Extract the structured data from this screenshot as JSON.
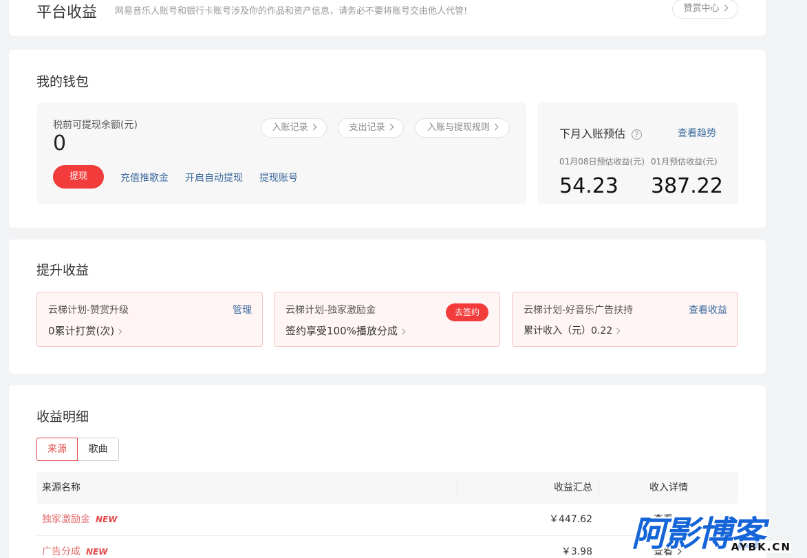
{
  "header": {
    "title": "平台收益",
    "notice": "网易音乐人账号和银行卡账号涉及你的作品和资产信息，请务必不要将账号交由他人代管!",
    "reward_center": "赞赏中心"
  },
  "wallet": {
    "title": "我的钱包",
    "balance_label": "税前可提现余额(元)",
    "balance_value": "0",
    "records": [
      "入账记录",
      "支出记录",
      "入账与提现规则"
    ],
    "withdraw": "提现",
    "actions": [
      "充值推歌金",
      "开启自动提现",
      "提现账号"
    ],
    "forecast": {
      "title": "下月入账预估",
      "trend": "查看趋势",
      "day_label": "01月08日预估收益(元)",
      "day_value": "54.23",
      "month_label": "01月预估收益(元)",
      "month_value": "387.22"
    }
  },
  "boost": {
    "title": "提升收益",
    "plans": [
      {
        "title": "云梯计划-赞赏升级",
        "value": "0累计打赏(次)",
        "action": "管理"
      },
      {
        "title": "云梯计划-独家激励金",
        "value": "签约享受100%播放分成",
        "action": "去签约"
      },
      {
        "title": "云梯计划-好音乐广告扶持",
        "value": "累计收入（元）0.22",
        "action": "查看收益"
      }
    ]
  },
  "detail": {
    "title": "收益明细",
    "tabs": [
      "来源",
      "歌曲"
    ],
    "columns": [
      "来源名称",
      "收益汇总",
      "收入详情"
    ],
    "rows": [
      {
        "name": "独家激励金",
        "badge": "NEW",
        "sum": "￥447.62",
        "detail": "查看"
      },
      {
        "name": "广告分成",
        "badge": "NEW",
        "sum": "￥3.98",
        "detail": "查看"
      }
    ]
  },
  "watermark": {
    "main": "阿影博客",
    "sub": "AYBK.CN"
  },
  "colors": {
    "accent": "#f23c3c",
    "link": "#3d6a9e",
    "new_badge": "#e34a4a"
  }
}
